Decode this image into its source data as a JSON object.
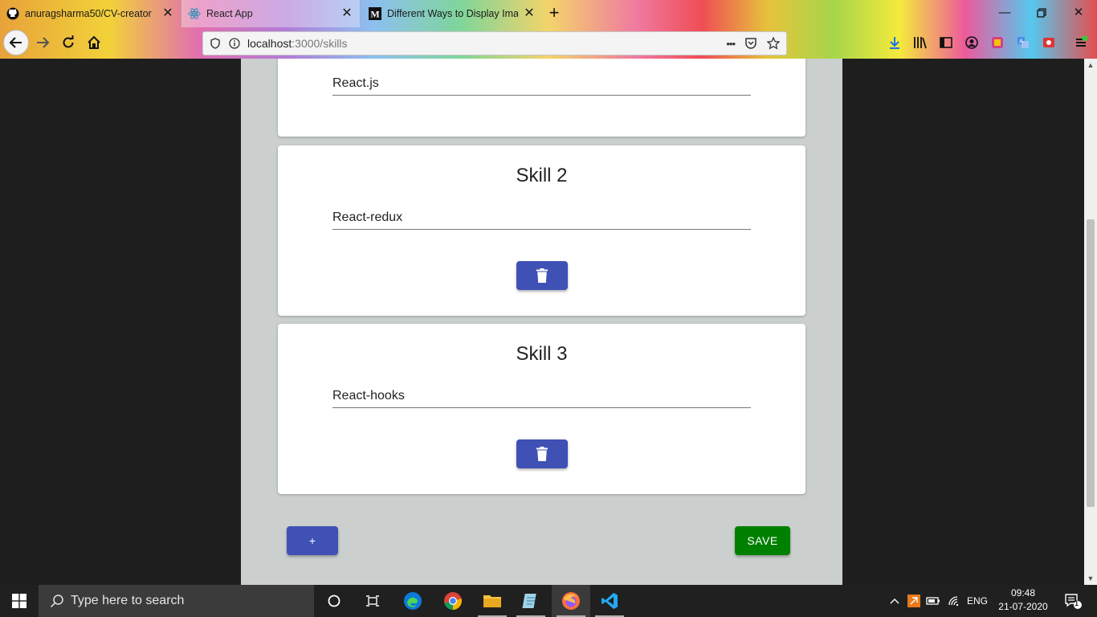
{
  "browser": {
    "tabs": [
      {
        "title": "anuragsharma50/CV-creator",
        "icon": "github-icon",
        "active": false
      },
      {
        "title": "React App",
        "icon": "react-icon",
        "active": true
      },
      {
        "title": "Different Ways to Display Ima",
        "icon": "medium-icon",
        "active": false
      }
    ],
    "url_host": "localhost",
    "url_path": ":3000/skills",
    "overflow_label": "•••"
  },
  "page": {
    "skills": [
      {
        "title": "",
        "value": "React.js"
      },
      {
        "title": "Skill 2",
        "value": "React-redux"
      },
      {
        "title": "Skill 3",
        "value": "React-hooks"
      }
    ],
    "add_label": "+",
    "save_label": "SAVE",
    "colors": {
      "primary": "#3f51b5",
      "save": "#008000",
      "background": "#cbd0ce"
    }
  },
  "taskbar": {
    "search_placeholder": "Type here to search",
    "language": "ENG",
    "time": "09:48",
    "date": "21-07-2020",
    "notification_count": "1"
  }
}
